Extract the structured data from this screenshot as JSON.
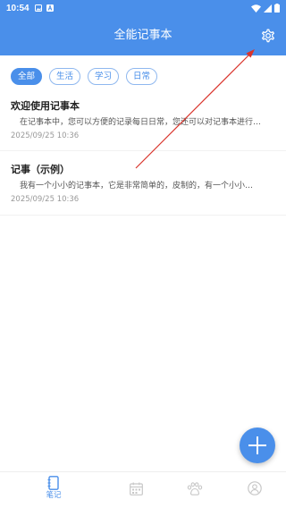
{
  "status_bar": {
    "time": "10:54",
    "icons": [
      "image-notification-icon",
      "a-notification-icon",
      "wifi-icon",
      "signal-icon",
      "battery-icon"
    ]
  },
  "app_bar": {
    "title": "全能记事本",
    "settings_icon": "gear-icon"
  },
  "filters": {
    "selected": "全部",
    "chips": [
      {
        "label": "全部"
      },
      {
        "label": "生活"
      },
      {
        "label": "学习"
      },
      {
        "label": "日常"
      }
    ]
  },
  "notes": [
    {
      "title": "欢迎使用记事本",
      "preview": "在记事本中，您可以方便的记录每日日常，您还可以对记事本进行…",
      "time": "2025/09/25 10:36"
    },
    {
      "title": "记事（示例）",
      "preview": "我有一个小小的记事本，它是非常简单的，皮制的，有一个小小…",
      "time": "2025/09/25 10:36"
    }
  ],
  "fab": {
    "icon": "plus-icon"
  },
  "bottom_nav": {
    "selected": "笔记",
    "items": [
      {
        "label": "笔记",
        "icon": "notebook-icon"
      },
      {
        "label": "",
        "icon": "calendar-icon"
      },
      {
        "label": "",
        "icon": "paw-icon"
      },
      {
        "label": "",
        "icon": "user-icon"
      }
    ]
  },
  "colors": {
    "primary": "#4a8fea",
    "annotation_arrow": "#d9332b"
  }
}
